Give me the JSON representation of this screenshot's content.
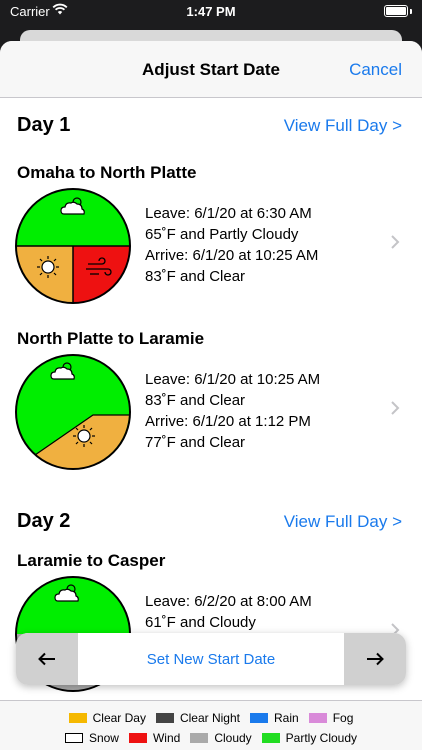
{
  "status_bar": {
    "carrier": "Carrier",
    "time": "1:47 PM"
  },
  "nav": {
    "title": "Adjust Start Date",
    "cancel": "Cancel"
  },
  "days": [
    {
      "title": "Day 1",
      "link": "View Full Day >",
      "legs": [
        {
          "title": "Omaha to North Platte",
          "leave": "Leave: 6/1/20 at 6:30 AM",
          "leave_weather": "65˚F and Partly Cloudy",
          "arrive": "Arrive: 6/1/20 at 10:25 AM",
          "arrive_weather": "83˚F and Clear"
        },
        {
          "title": "North Platte to Laramie",
          "leave": "Leave: 6/1/20 at 10:25 AM",
          "leave_weather": "83˚F and Clear",
          "arrive": "Arrive: 6/1/20 at 1:12 PM",
          "arrive_weather": "77˚F and Clear"
        }
      ]
    },
    {
      "title": "Day 2",
      "link": "View Full Day >",
      "legs": [
        {
          "title": "Laramie to Casper",
          "leave": "Leave: 6/2/20 at 8:00 AM",
          "leave_weather": "61˚F and Cloudy"
        }
      ]
    }
  ],
  "bottom_bar": {
    "set_label": "Set New Start Date"
  },
  "legend": {
    "items": [
      {
        "label": "Clear Day",
        "color": "#f5b800"
      },
      {
        "label": "Clear Night",
        "color": "#444444"
      },
      {
        "label": "Rain",
        "color": "#1a7aec"
      },
      {
        "label": "Fog",
        "color": "#d98ad9"
      },
      {
        "label": "Snow",
        "color": "#ffffff"
      },
      {
        "label": "Wind",
        "color": "#ee1111"
      },
      {
        "label": "Cloudy",
        "color": "#aaaaaa"
      },
      {
        "label": "Partly Cloudy",
        "color": "#22dd22"
      }
    ]
  },
  "colors": {
    "accent": "#1a7aec",
    "clear_day": "#f0b040",
    "partly_cloudy": "#00ee00",
    "wind": "#ee1111"
  },
  "icons": [
    "wifi-icon",
    "battery-icon",
    "partly-cloudy-icon",
    "sun-icon",
    "wind-icon",
    "chevron-right-icon",
    "arrow-left-icon",
    "arrow-right-icon"
  ]
}
